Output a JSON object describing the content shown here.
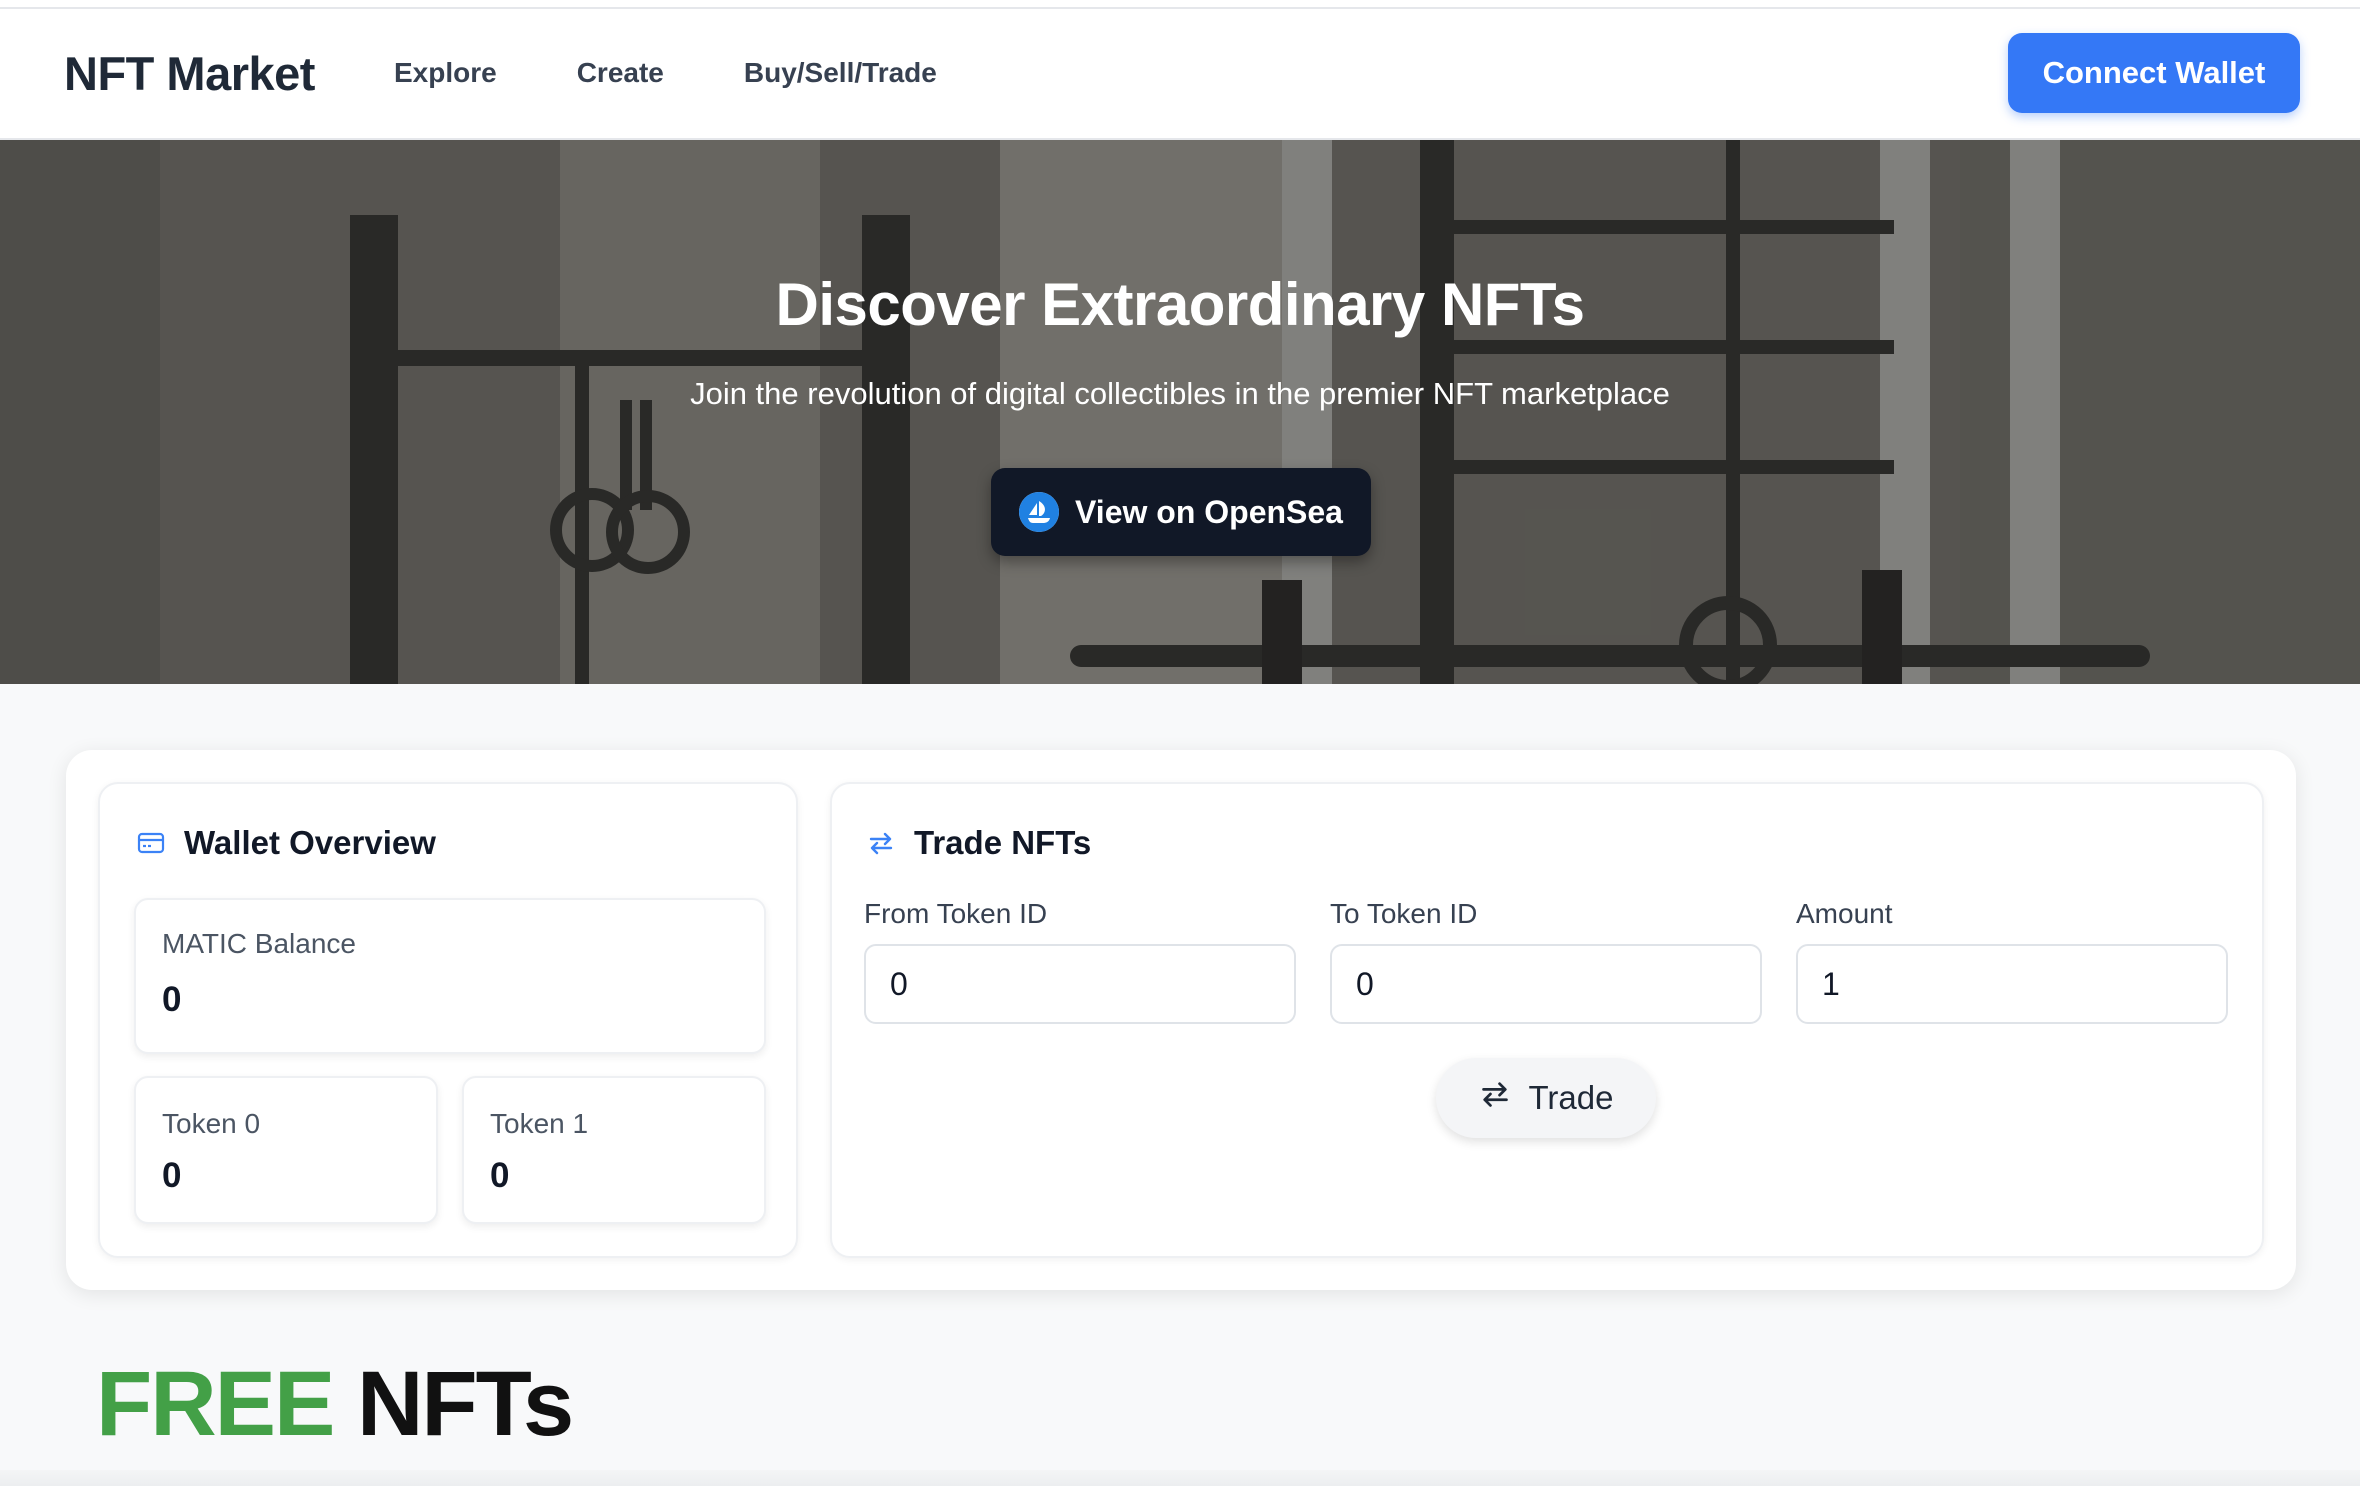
{
  "header": {
    "brand": "NFT Market",
    "nav": [
      {
        "label": "Explore"
      },
      {
        "label": "Create"
      },
      {
        "label": "Buy/Sell/Trade"
      }
    ],
    "connect_label": "Connect Wallet"
  },
  "hero": {
    "title": "Discover Extraordinary NFTs",
    "subtitle": "Join the revolution of digital collectibles in the premier NFT marketplace",
    "opensea_label": "View on OpenSea"
  },
  "wallet": {
    "title": "Wallet Overview",
    "matic_label": "MATIC Balance",
    "matic_value": "0",
    "token0_label": "Token 0",
    "token0_value": "0",
    "token1_label": "Token 1",
    "token1_value": "0"
  },
  "trade": {
    "title": "Trade NFTs",
    "from_label": "From Token ID",
    "from_value": "0",
    "to_label": "To Token ID",
    "to_value": "0",
    "amount_label": "Amount",
    "amount_value": "1",
    "button_label": "Trade"
  },
  "free_section": {
    "title_accent": "FREE",
    "title_rest": "NFTs"
  },
  "colors": {
    "accent": "#3478f6",
    "dark_button": "#111827",
    "free_green": "#43a047"
  },
  "icons": {
    "wallet": "card-icon",
    "trade": "swap-arrows-icon",
    "opensea": "opensea-boat-icon"
  }
}
